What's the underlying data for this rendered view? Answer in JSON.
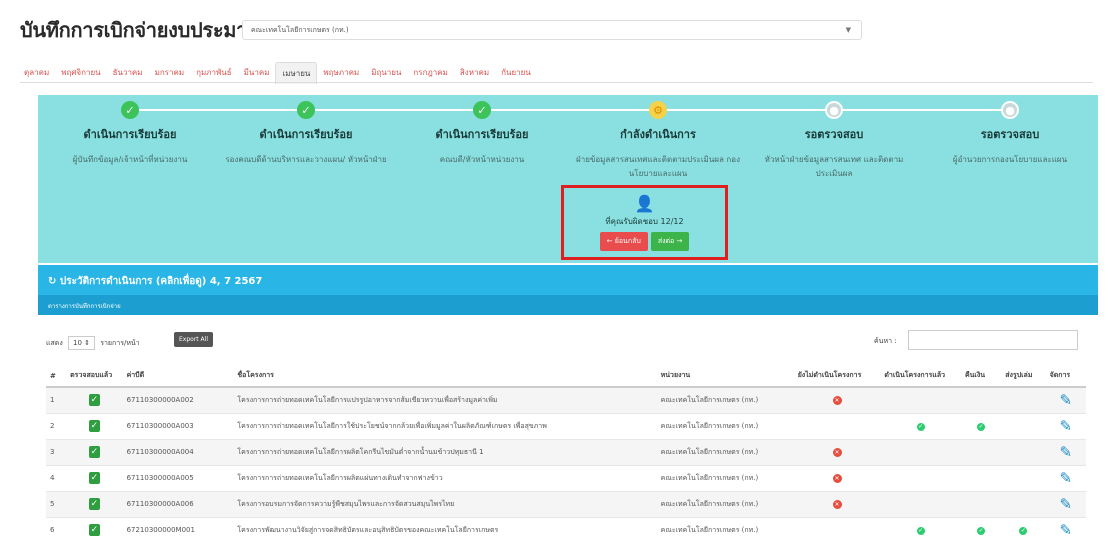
{
  "page_title": "บันทึกการเบิกจ่ายงบประมาณ",
  "department_select": "คณะเทคโนโลยีการเกษตร (กท.)",
  "months": [
    "ตุลาคม",
    "พฤศจิกายน",
    "ธันวาคม",
    "มกราคม",
    "กุมภาพันธ์",
    "มีนาคม",
    "เมษายน",
    "พฤษภาคม",
    "มิถุนายน",
    "กรกฎาคม",
    "สิงหาคม",
    "กันยายน"
  ],
  "active_month": "เมษายน",
  "steps": [
    {
      "title": "ดำเนินการเรียบร้อย",
      "desc": "ผู้บันทึกข้อมูล/เจ้าหน้าที่หน่วยงาน",
      "status": "done"
    },
    {
      "title": "ดำเนินการเรียบร้อย",
      "desc": "รองคณบดีด้านบริหารและวางแผน/ หัวหน้าฝ่าย",
      "status": "done"
    },
    {
      "title": "ดำเนินการเรียบร้อย",
      "desc": "คณบดี/หัวหน้าหน่วยงาน",
      "status": "done"
    },
    {
      "title": "กำลังดำเนินการ",
      "desc": "ฝ่ายข้อมูลสารสนเทศและติดตามประเมินผล กองนโยบายและแผน",
      "status": "current"
    },
    {
      "title": "รอตรวจสอบ",
      "desc": "หัวหน้าฝ่ายข้อมูลสารสนเทศ และติดตามประเมินผล",
      "status": "pending"
    },
    {
      "title": "รอตรวจสอบ",
      "desc": "ผู้อำนวยการกองนโยบายและแผน",
      "status": "pending"
    }
  ],
  "assignment": {
    "text": "ที่คุณรับผิดชอบ 12/12",
    "back_label": "← ย้อนกลับ",
    "next_label": "ส่งต่อ →"
  },
  "history_title": "ประวัติการดำเนินการ (คลิกเพื่อดู) 4, 7 2567",
  "subbar_title": "ตารางการบันทึกการเบิกจ่าย",
  "controls": {
    "show_label": "แสดง",
    "show_value": "10",
    "per_page_label": "รายการ/หน้า",
    "export_label": "Export All",
    "search_label": "ค้นหา :"
  },
  "table": {
    "headers": [
      "#",
      "ตรวจสอบแล้ว",
      "ค่าบีดี",
      "ชื่อโครงการ",
      "หน่วยงาน",
      "ยังไม่ดำเนินโครงการ",
      "ดำเนินโครงการแล้ว",
      "คืนเงิน",
      "ส่งรูปเล่ม",
      "จัดการ"
    ],
    "rows": [
      {
        "no": "1",
        "code": "67110300000A002",
        "name": "โครงการการถ่ายทอดเทคโนโลยีการแปรรูปอาหารจากส้มเขียวหวานเพื่อสร้างมูลค่าเพิ่ม",
        "unit": "คณะเทคโนโลยีการเกษตร (กท.)",
        "not_started": true,
        "done": false,
        "refund": false,
        "report": false
      },
      {
        "no": "2",
        "code": "67110300000A003",
        "name": "โครงการการถ่ายทอดเทคโนโลยีการใช้ประโยชน์จากกล้วยเพื่อเพิ่มมูลค่าในผลิตภัณฑ์เกษตร เพื่อสุขภาพ",
        "unit": "คณะเทคโนโลยีการเกษตร (กท.)",
        "not_started": false,
        "done": true,
        "refund": true,
        "report": false
      },
      {
        "no": "3",
        "code": "67110300000A004",
        "name": "โครงการการถ่ายทอดเทคโนโลยีการผลิตโคกรีนไขมันต่ำจากน้ำนมข้าวปทุมธานี 1",
        "unit": "คณะเทคโนโลยีการเกษตร (กท.)",
        "not_started": true,
        "done": false,
        "refund": false,
        "report": false
      },
      {
        "no": "4",
        "code": "67110300000A005",
        "name": "โครงการการถ่ายทอดเทคโนโลยีการผลิตแผ่นทางเดินทำจากฟางข้าว",
        "unit": "คณะเทคโนโลยีการเกษตร (กท.)",
        "not_started": true,
        "done": false,
        "refund": false,
        "report": false
      },
      {
        "no": "5",
        "code": "67110300000A006",
        "name": "โครงการอบรมการจัดการความรู้พืชสมุนไพรและการจัดสวนสมุนไพรไทย",
        "unit": "คณะเทคโนโลยีการเกษตร (กท.)",
        "not_started": true,
        "done": false,
        "refund": false,
        "report": false
      },
      {
        "no": "6",
        "code": "67210300000M001",
        "name": "โครงการพัฒนางานวิจัยสู่การจดสิทธิบัตรและอนุสิทธิบัตรของคณะเทคโนโลยีการเกษตร",
        "unit": "คณะเทคโนโลยีการเกษตร (กท.)",
        "not_started": false,
        "done": true,
        "refund": true,
        "report": true
      }
    ]
  }
}
